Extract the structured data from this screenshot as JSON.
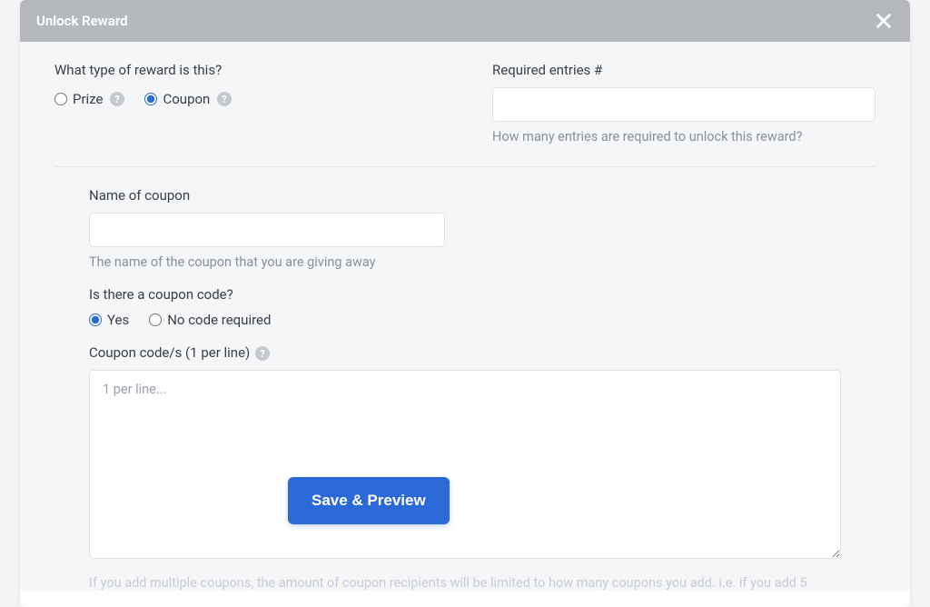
{
  "modal": {
    "title": "Unlock Reward"
  },
  "rewardType": {
    "question": "What type of reward is this?",
    "options": {
      "prize": "Prize",
      "coupon": "Coupon"
    },
    "selected": "coupon"
  },
  "requiredEntries": {
    "label": "Required entries #",
    "value": "",
    "help": "How many entries are required to unlock this reward?"
  },
  "couponName": {
    "label": "Name of coupon",
    "value": "",
    "help": "The name of the coupon that you are giving away"
  },
  "hasCode": {
    "question": "Is there a coupon code?",
    "options": {
      "yes": "Yes",
      "no": "No code required"
    },
    "selected": "yes"
  },
  "couponCodes": {
    "label": "Coupon code/s (1 per line)",
    "placeholder": "1 per line...",
    "value": "",
    "help": "If you add multiple coupons, the amount of coupon recipients will be limited to how many coupons you add. i.e. if you add 5"
  },
  "actions": {
    "save": "Save & Preview"
  }
}
